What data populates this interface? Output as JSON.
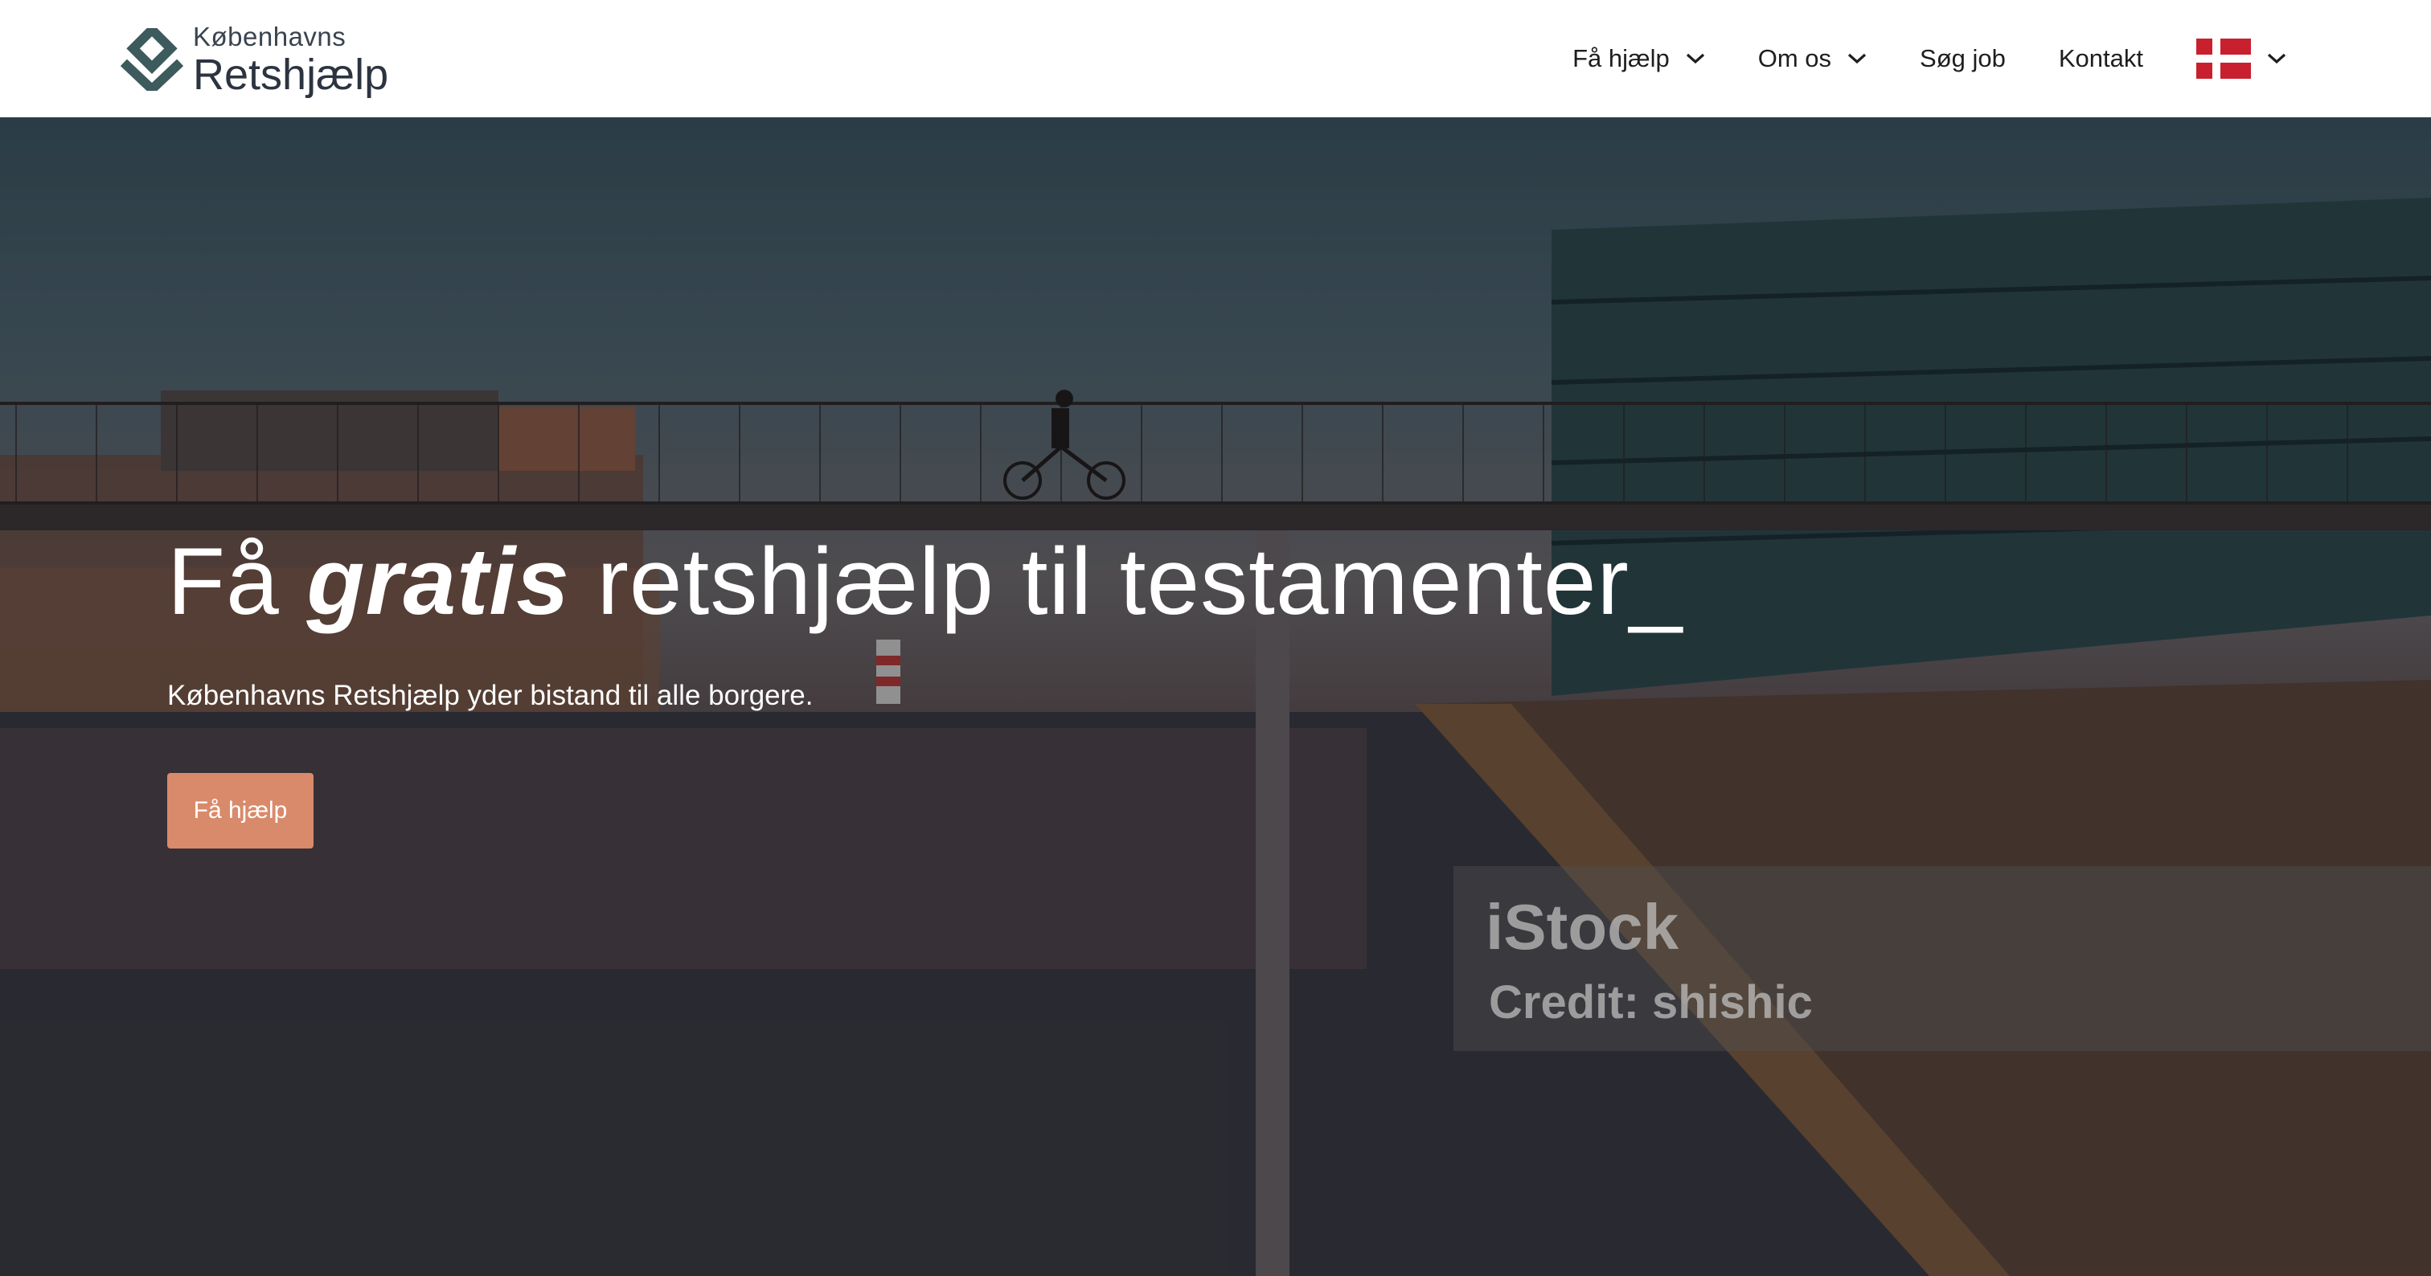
{
  "header": {
    "logo": {
      "line1": "Københavns",
      "line2": "Retshjælp"
    },
    "nav": {
      "items": [
        {
          "label": "Få hjælp",
          "has_dropdown": true
        },
        {
          "label": "Om os",
          "has_dropdown": true
        },
        {
          "label": "Søg job",
          "has_dropdown": false
        },
        {
          "label": "Kontakt",
          "has_dropdown": false
        }
      ],
      "language": {
        "icon": "danish-flag-icon",
        "has_dropdown": true
      }
    }
  },
  "hero": {
    "title_prefix": "Få ",
    "title_emphasis": "gratis",
    "title_suffix": " retshjælp til testamenter_",
    "subtitle": "Københavns Retshjælp yder bistand til alle borgere.",
    "cta_label": "Få hjælp",
    "watermark": {
      "brand": "iStock",
      "credit": "Credit: shishic"
    }
  },
  "colors": {
    "logo": "#3d5a5c",
    "cta": "#d98a6a",
    "flag_red": "#c8202f"
  }
}
